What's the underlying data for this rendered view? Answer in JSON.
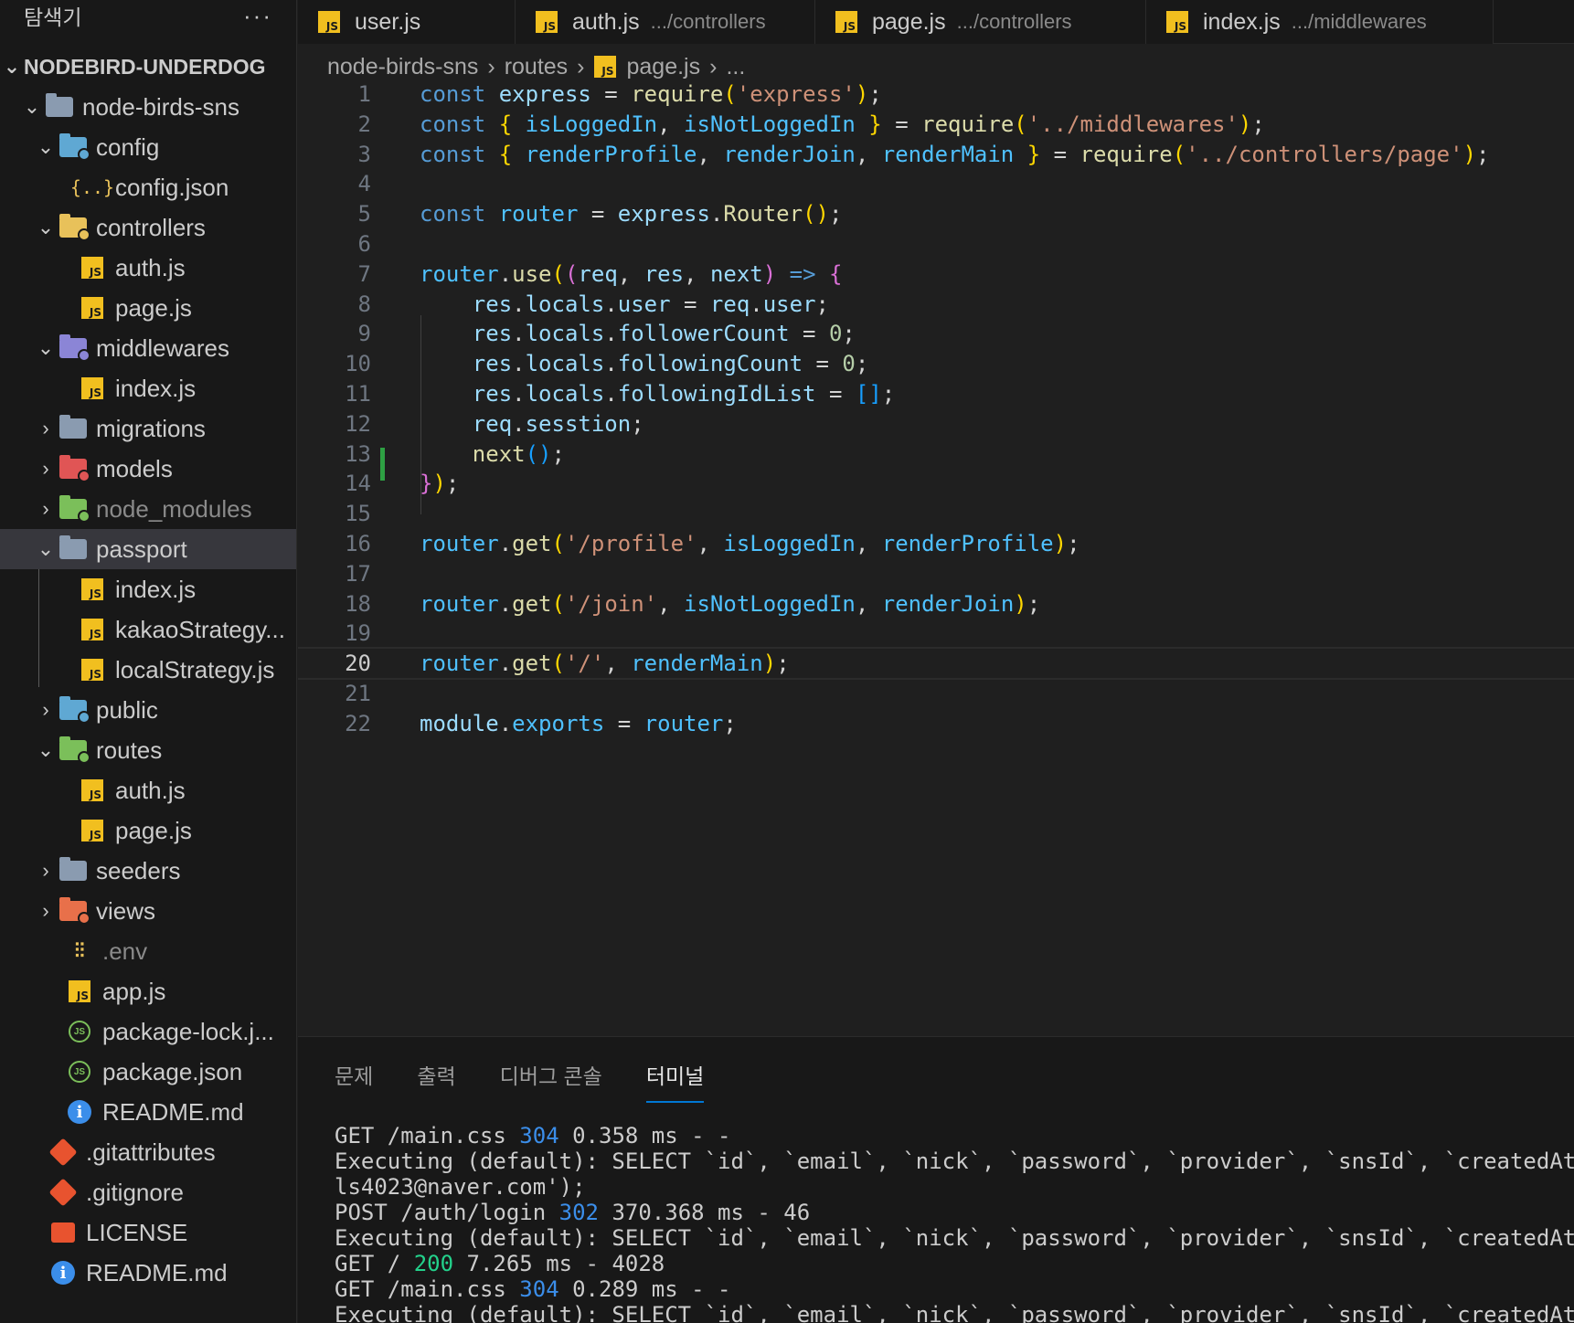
{
  "explorer": {
    "title": "탐색기",
    "more": "···",
    "project": "NODEBIRD-UNDERDOG",
    "items": [
      {
        "label": "node-birds-sns",
        "kind": "folder-open",
        "chev": "⌄"
      },
      {
        "label": "config",
        "kind": "folder-config",
        "chev": "⌄"
      },
      {
        "label": "config.json",
        "kind": "json"
      },
      {
        "label": "controllers",
        "kind": "folder-controllers",
        "chev": "⌄"
      },
      {
        "label": "auth.js",
        "kind": "js"
      },
      {
        "label": "page.js",
        "kind": "js"
      },
      {
        "label": "middlewares",
        "kind": "folder-middlewares",
        "chev": "⌄"
      },
      {
        "label": "index.js",
        "kind": "js"
      },
      {
        "label": "migrations",
        "kind": "folder",
        "chev": "›"
      },
      {
        "label": "models",
        "kind": "folder-models",
        "chev": "›"
      },
      {
        "label": "node_modules",
        "kind": "folder-node",
        "chev": "›"
      },
      {
        "label": "passport",
        "kind": "folder-open",
        "chev": "⌄"
      },
      {
        "label": "index.js",
        "kind": "js"
      },
      {
        "label": "kakaoStrategy...",
        "kind": "js"
      },
      {
        "label": "localStrategy.js",
        "kind": "js"
      },
      {
        "label": "public",
        "kind": "folder-public",
        "chev": "›"
      },
      {
        "label": "routes",
        "kind": "folder-routes",
        "chev": "⌄"
      },
      {
        "label": "auth.js",
        "kind": "js"
      },
      {
        "label": "page.js",
        "kind": "js"
      },
      {
        "label": "seeders",
        "kind": "folder",
        "chev": "›"
      },
      {
        "label": "views",
        "kind": "folder-views",
        "chev": "›"
      },
      {
        "label": ".env",
        "kind": "env"
      },
      {
        "label": "app.js",
        "kind": "js"
      },
      {
        "label": "package-lock.j...",
        "kind": "node"
      },
      {
        "label": "package.json",
        "kind": "node"
      },
      {
        "label": "README.md",
        "kind": "info"
      },
      {
        "label": ".gitattributes",
        "kind": "git"
      },
      {
        "label": ".gitignore",
        "kind": "git"
      },
      {
        "label": "LICENSE",
        "kind": "license"
      },
      {
        "label": "README.md",
        "kind": "info"
      }
    ]
  },
  "tabs": [
    {
      "name": "user.js",
      "path": ""
    },
    {
      "name": "auth.js",
      "path": ".../controllers"
    },
    {
      "name": "page.js",
      "path": ".../controllers"
    },
    {
      "name": "index.js",
      "path": ".../middlewares"
    }
  ],
  "breadcrumb": [
    "node-birds-sns",
    "routes",
    "page.js",
    "..."
  ],
  "js_badge": "JS",
  "editor": {
    "current_line": 20,
    "lines": [
      [
        [
          "kw",
          "const "
        ],
        [
          "var",
          "express"
        ],
        [
          "pun",
          " = "
        ],
        [
          "fn",
          "require"
        ],
        [
          "br1",
          "("
        ],
        [
          "str",
          "'express'"
        ],
        [
          "br1",
          ")"
        ],
        [
          "pun",
          ";"
        ]
      ],
      [
        [
          "kw",
          "const "
        ],
        [
          "br1",
          "{ "
        ],
        [
          "cst",
          "isLoggedIn"
        ],
        [
          "pun",
          ", "
        ],
        [
          "cst",
          "isNotLoggedIn"
        ],
        [
          "br1",
          " }"
        ],
        [
          "pun",
          " = "
        ],
        [
          "fn",
          "require"
        ],
        [
          "br1",
          "("
        ],
        [
          "str",
          "'../middlewares'"
        ],
        [
          "br1",
          ")"
        ],
        [
          "pun",
          ";"
        ]
      ],
      [
        [
          "kw",
          "const "
        ],
        [
          "br1",
          "{ "
        ],
        [
          "cst",
          "renderProfile"
        ],
        [
          "pun",
          ", "
        ],
        [
          "cst",
          "renderJoin"
        ],
        [
          "pun",
          ", "
        ],
        [
          "cst",
          "renderMain"
        ],
        [
          "br1",
          " }"
        ],
        [
          "pun",
          " = "
        ],
        [
          "fn",
          "require"
        ],
        [
          "br1",
          "("
        ],
        [
          "str",
          "'../controllers/page'"
        ],
        [
          "br1",
          ")"
        ],
        [
          "pun",
          ";"
        ]
      ],
      [],
      [
        [
          "kw",
          "const "
        ],
        [
          "cst",
          "router"
        ],
        [
          "pun",
          " = "
        ],
        [
          "var",
          "express"
        ],
        [
          "pun",
          "."
        ],
        [
          "fn",
          "Router"
        ],
        [
          "br1",
          "()"
        ],
        [
          "pun",
          ";"
        ]
      ],
      [],
      [
        [
          "cst",
          "router"
        ],
        [
          "pun",
          "."
        ],
        [
          "fn",
          "use"
        ],
        [
          "br1",
          "("
        ],
        [
          "br2",
          "("
        ],
        [
          "var",
          "req"
        ],
        [
          "pun",
          ", "
        ],
        [
          "var",
          "res"
        ],
        [
          "pun",
          ", "
        ],
        [
          "var",
          "next"
        ],
        [
          "br2",
          ")"
        ],
        [
          "kw",
          " => "
        ],
        [
          "br2",
          "{"
        ]
      ],
      [
        [
          "pun",
          "    "
        ],
        [
          "var",
          "res"
        ],
        [
          "pun",
          "."
        ],
        [
          "var",
          "locals"
        ],
        [
          "pun",
          "."
        ],
        [
          "var",
          "user"
        ],
        [
          "pun",
          " = "
        ],
        [
          "var",
          "req"
        ],
        [
          "pun",
          "."
        ],
        [
          "var",
          "user"
        ],
        [
          "pun",
          ";"
        ]
      ],
      [
        [
          "pun",
          "    "
        ],
        [
          "var",
          "res"
        ],
        [
          "pun",
          "."
        ],
        [
          "var",
          "locals"
        ],
        [
          "pun",
          "."
        ],
        [
          "var",
          "followerCount"
        ],
        [
          "pun",
          " = "
        ],
        [
          "num",
          "0"
        ],
        [
          "pun",
          ";"
        ]
      ],
      [
        [
          "pun",
          "    "
        ],
        [
          "var",
          "res"
        ],
        [
          "pun",
          "."
        ],
        [
          "var",
          "locals"
        ],
        [
          "pun",
          "."
        ],
        [
          "var",
          "followingCount"
        ],
        [
          "pun",
          " = "
        ],
        [
          "num",
          "0"
        ],
        [
          "pun",
          ";"
        ]
      ],
      [
        [
          "pun",
          "    "
        ],
        [
          "var",
          "res"
        ],
        [
          "pun",
          "."
        ],
        [
          "var",
          "locals"
        ],
        [
          "pun",
          "."
        ],
        [
          "var",
          "followingIdList"
        ],
        [
          "pun",
          " = "
        ],
        [
          "br3",
          "[]"
        ],
        [
          "pun",
          ";"
        ]
      ],
      [
        [
          "pun",
          "    "
        ],
        [
          "var",
          "req"
        ],
        [
          "pun",
          "."
        ],
        [
          "var",
          "sesstion"
        ],
        [
          "pun",
          ";"
        ]
      ],
      [
        [
          "pun",
          "    "
        ],
        [
          "fn",
          "next"
        ],
        [
          "br3",
          "()"
        ],
        [
          "pun",
          ";"
        ]
      ],
      [
        [
          "br2",
          "}"
        ],
        [
          "br1",
          ")"
        ],
        [
          "pun",
          ";"
        ]
      ],
      [],
      [
        [
          "cst",
          "router"
        ],
        [
          "pun",
          "."
        ],
        [
          "fn",
          "get"
        ],
        [
          "br1",
          "("
        ],
        [
          "str",
          "'/profile'"
        ],
        [
          "pun",
          ", "
        ],
        [
          "cst",
          "isLoggedIn"
        ],
        [
          "pun",
          ", "
        ],
        [
          "cst",
          "renderProfile"
        ],
        [
          "br1",
          ")"
        ],
        [
          "pun",
          ";"
        ]
      ],
      [],
      [
        [
          "cst",
          "router"
        ],
        [
          "pun",
          "."
        ],
        [
          "fn",
          "get"
        ],
        [
          "br1",
          "("
        ],
        [
          "str",
          "'/join'"
        ],
        [
          "pun",
          ", "
        ],
        [
          "cst",
          "isNotLoggedIn"
        ],
        [
          "pun",
          ", "
        ],
        [
          "cst",
          "renderJoin"
        ],
        [
          "br1",
          ")"
        ],
        [
          "pun",
          ";"
        ]
      ],
      [],
      [
        [
          "cst",
          "router"
        ],
        [
          "pun",
          "."
        ],
        [
          "fn",
          "get"
        ],
        [
          "br1",
          "("
        ],
        [
          "str",
          "'/'"
        ],
        [
          "pun",
          ", "
        ],
        [
          "cst",
          "renderMain"
        ],
        [
          "br1",
          ")"
        ],
        [
          "pun",
          ";"
        ]
      ],
      [],
      [
        [
          "var",
          "module"
        ],
        [
          "pun",
          "."
        ],
        [
          "cst",
          "exports"
        ],
        [
          "pun",
          " = "
        ],
        [
          "cst",
          "router"
        ],
        [
          "pun",
          ";"
        ]
      ]
    ]
  },
  "panel": {
    "tabs": [
      "문제",
      "출력",
      "디버그 콘솔",
      "터미널"
    ],
    "active_tab": 3,
    "terminal": [
      [
        [
          "t",
          "GET /main.css "
        ],
        [
          "b",
          "304"
        ],
        [
          "t",
          " 0.358 ms - -"
        ]
      ],
      [
        [
          "t",
          "Executing (default): SELECT `id`, `email`, `nick`, `password`, `provider`, `snsId`, `createdAt`, "
        ]
      ],
      [
        [
          "t",
          "ls4023@naver.com');"
        ]
      ],
      [
        [
          "t",
          "POST /auth/login "
        ],
        [
          "b",
          "302"
        ],
        [
          "t",
          " 370.368 ms - 46"
        ]
      ],
      [
        [
          "t",
          "Executing (default): SELECT `id`, `email`, `nick`, `password`, `provider`, `snsId`, `createdAt`, "
        ]
      ],
      [
        [
          "t",
          "GET / "
        ],
        [
          "g",
          "200"
        ],
        [
          "t",
          " 7.265 ms - 4028"
        ]
      ],
      [
        [
          "t",
          "GET /main.css "
        ],
        [
          "b",
          "304"
        ],
        [
          "t",
          " 0.289 ms - -"
        ]
      ],
      [
        [
          "t",
          "Executing (default): SELECT `id`, `email`, `nick`, `password`, `provider`, `snsId`, `createdAt`, "
        ]
      ]
    ]
  },
  "colors": {
    "folder": "#8a9bb0",
    "folder_config": "#5fa8d3",
    "folder_controllers": "#e8c15a",
    "folder_middlewares": "#8b85d6",
    "folder_models": "#e05555",
    "folder_node": "#7bbf5a",
    "folder_public": "#5fa8d3",
    "folder_routes": "#7bbf5a",
    "folder_views": "#e8704a"
  }
}
